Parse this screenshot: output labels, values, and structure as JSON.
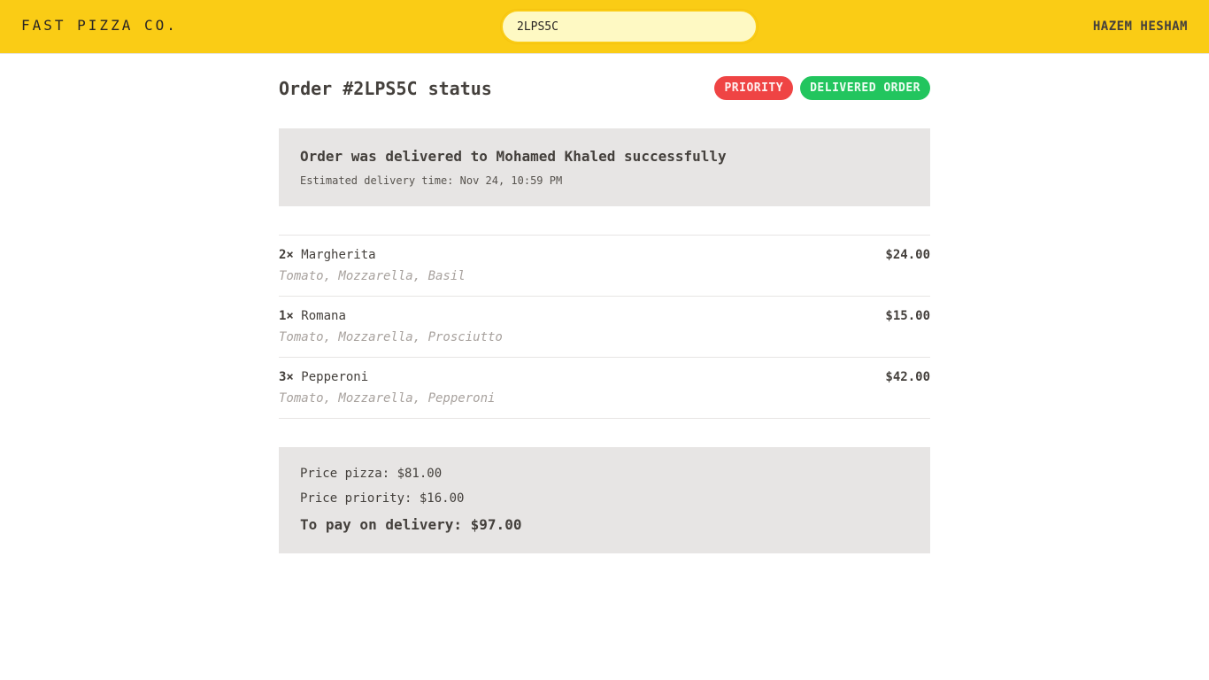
{
  "header": {
    "brand": "FAST PIZZA CO.",
    "search_value": "2LPS5C",
    "username": "HAZEM HESHAM"
  },
  "order": {
    "title": "Order #2LPS5C status",
    "badges": {
      "priority": "PRIORITY",
      "status": "DELIVERED ORDER"
    },
    "delivered_message": "Order was delivered to Mohamed Khaled successfully",
    "estimated_delivery": "Estimated delivery time: Nov 24, 10:59 PM"
  },
  "items": [
    {
      "quantity": "2×",
      "name": "Margherita",
      "price": "$24.00",
      "ingredients": "Tomato, Mozzarella, Basil"
    },
    {
      "quantity": "1×",
      "name": "Romana",
      "price": "$15.00",
      "ingredients": "Tomato, Mozzarella, Prosciutto"
    },
    {
      "quantity": "3×",
      "name": "Pepperoni",
      "price": "$42.00",
      "ingredients": "Tomato, Mozzarella, Pepperoni"
    }
  ],
  "prices": {
    "pizza": "Price pizza: $81.00",
    "priority": "Price priority: $16.00",
    "to_pay": "To pay on delivery: $97.00"
  },
  "colors": {
    "header_bg": "#facc15",
    "priority_badge": "#ef4444",
    "status_badge": "#22c55e",
    "panel_bg": "#e7e5e4"
  }
}
